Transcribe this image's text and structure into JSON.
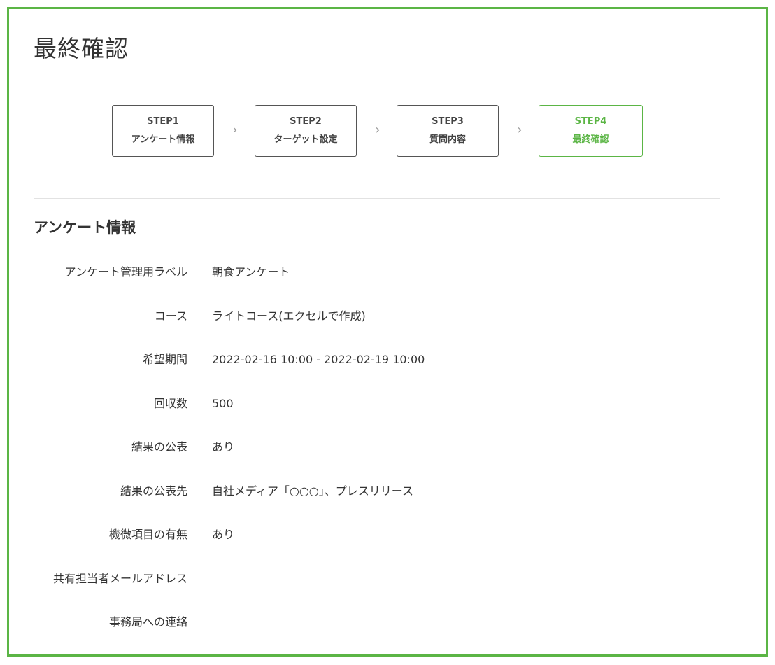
{
  "page": {
    "title": "最終確認"
  },
  "steps": [
    {
      "num": "STEP1",
      "label": "アンケート情報",
      "active": false
    },
    {
      "num": "STEP2",
      "label": "ターゲット設定",
      "active": false
    },
    {
      "num": "STEP3",
      "label": "質問内容",
      "active": false
    },
    {
      "num": "STEP4",
      "label": "最終確認",
      "active": true
    }
  ],
  "step_separator": "›",
  "section": {
    "title": "アンケート情報",
    "rows": [
      {
        "label": "アンケート管理用ラベル",
        "value": "朝食アンケート"
      },
      {
        "label": "コース",
        "value": "ライトコース(エクセルで作成)"
      },
      {
        "label": "希望期間",
        "value": "2022-02-16 10:00 - 2022-02-19 10:00"
      },
      {
        "label": "回収数",
        "value": "500"
      },
      {
        "label": "結果の公表",
        "value": "あり"
      },
      {
        "label": "結果の公表先",
        "value": "自社メディア「○○○」、プレスリリース"
      },
      {
        "label": "機微項目の有無",
        "value": "あり"
      },
      {
        "label": "共有担当者メールアドレス",
        "value": ""
      },
      {
        "label": "事務局への連絡",
        "value": ""
      }
    ]
  },
  "colors": {
    "accent": "#5bb545",
    "text": "#333333",
    "border": "#555555",
    "divider": "#e2e2e2"
  }
}
